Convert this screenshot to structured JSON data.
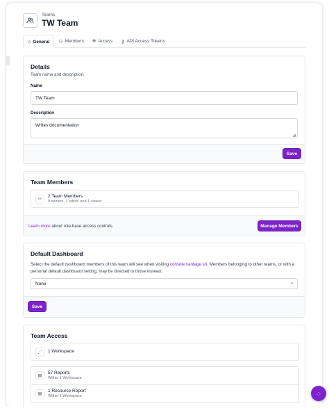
{
  "header": {
    "breadcrumb": "Teams",
    "title": "TW Team"
  },
  "tabs": [
    {
      "label": "General",
      "icon": "home-icon"
    },
    {
      "label": "Members",
      "icon": "user-icon"
    },
    {
      "label": "Access",
      "icon": "access-icon"
    },
    {
      "label": "API Access Tokens",
      "icon": "key-icon"
    }
  ],
  "details": {
    "title": "Details",
    "subtitle": "Team name and description.",
    "name_label": "Name",
    "name_value": "TW Team",
    "description_label": "Description",
    "description_value": "Writes documentation",
    "save_label": "Save"
  },
  "members": {
    "title": "Team Members",
    "count_label": "2 Team Members",
    "breakdown": "0 owners, 1 editor, and 1 viewer",
    "learn_more": "Learn more",
    "learn_more_rest": " about role-base access controls.",
    "manage_label": "Manage Members"
  },
  "dashboard": {
    "title": "Default Dashboard",
    "desc_before": "Select the default dashboard members of this team will see when visiting ",
    "desc_link": "console.vantage.sh",
    "desc_after": ". Members belonging to other teams, or with a personal default dashboard setting, may be directed to those instead.",
    "select_value": "None",
    "save_label": "Save"
  },
  "access": {
    "title": "Team Access",
    "workspace": "1 Workspace",
    "items": [
      {
        "title": "57 Reports",
        "sub": "Within 1 Workspace"
      },
      {
        "title": "1 Resource Report",
        "sub": "Within 1 Workspace"
      }
    ]
  },
  "colors": {
    "accent": "#7e22ce",
    "border": "#e5e7eb",
    "footer_bg": "#f9fafb"
  }
}
